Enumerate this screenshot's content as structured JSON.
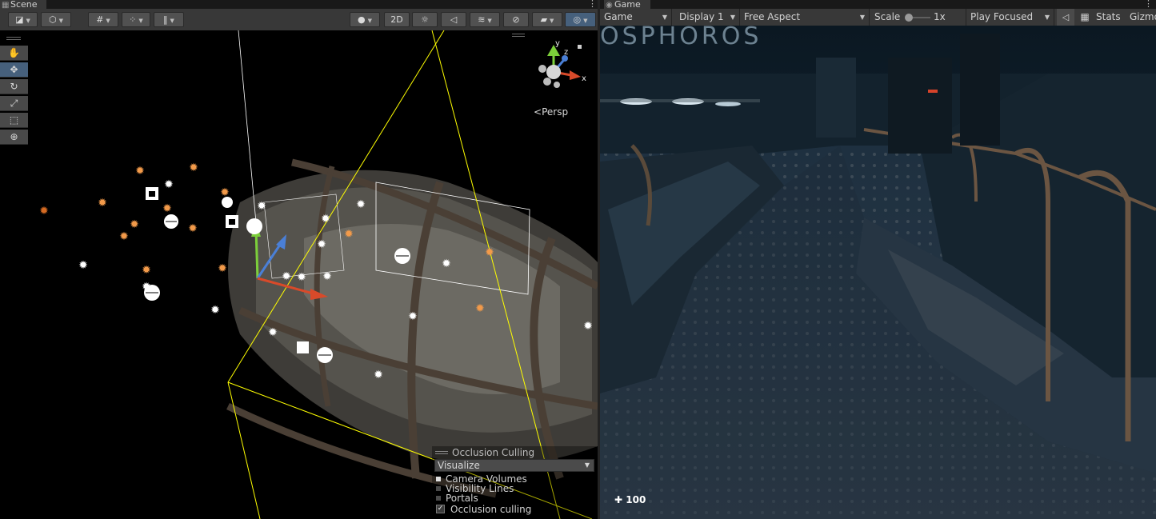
{
  "scene_panel": {
    "tab_label": "Scene",
    "toolbar": {
      "mode_2d_label": "2D"
    },
    "persp_label": "Persp",
    "gizmo_axes": {
      "y": "y",
      "z": "z",
      "x": "x"
    },
    "overlay": {
      "title": "Occlusion Culling",
      "mode_dropdown": "Visualize",
      "options": [
        {
          "label": "Camera Volumes",
          "checked": true
        },
        {
          "label": "Visibility Lines",
          "checked": false
        },
        {
          "label": "Portals",
          "checked": false
        }
      ],
      "occlusion_toggle": {
        "label": "Occlusion culling",
        "checked": true
      }
    }
  },
  "game_panel": {
    "tab_label": "Game",
    "toolbar": {
      "view_select": "Game",
      "display_select": "Display 1",
      "aspect_select": "Free Aspect",
      "scale_label": "Scale",
      "scale_value": "1x",
      "play_mode_select": "Play Focused",
      "stats_label": "Stats",
      "gizmos_label": "Gizmo"
    },
    "sign_text": "OSPHOROS",
    "counter": "100"
  },
  "colors": {
    "selection_accent": "#46607c",
    "camera_frustum": "#ffff00",
    "light_orange": "#f29a4a",
    "axis_y": "#7ccf3a",
    "axis_z": "#4a7fd6",
    "axis_x": "#d84a2a"
  },
  "icons": {
    "scene_tab": "grid-icon",
    "game_tab": "gamepad-icon",
    "tools": [
      "hand-icon",
      "move-icon",
      "rotate-icon",
      "scale-icon",
      "rect-icon",
      "transform-icon"
    ]
  }
}
